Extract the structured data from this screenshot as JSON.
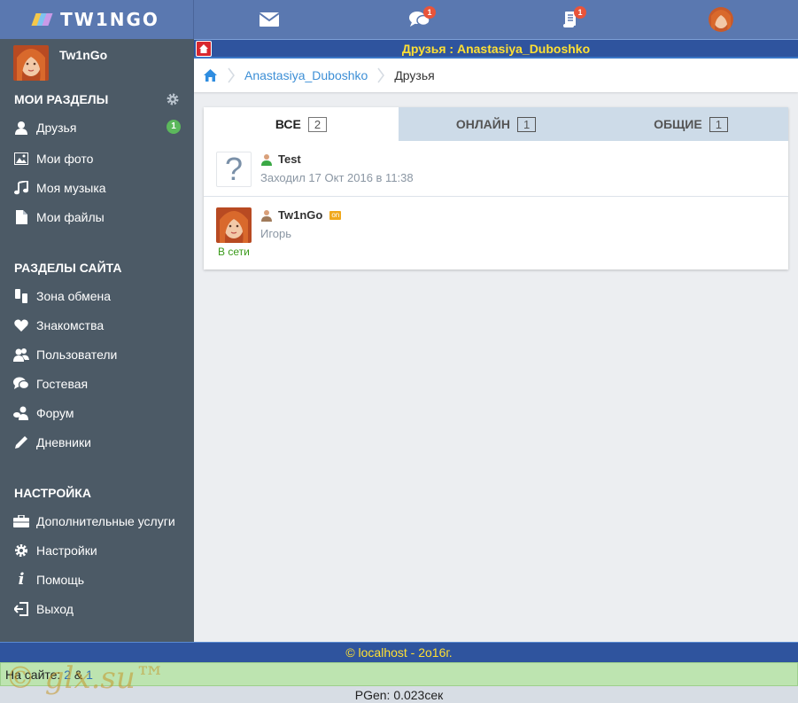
{
  "logo": {
    "text": "TW1NGO"
  },
  "topbar": {
    "messages_icon": "envelope-icon",
    "comments_badge": "1",
    "notifications_badge": "1"
  },
  "sidebar": {
    "username": "Tw1nGo",
    "my_sections": {
      "title": "МОИ РАЗДЕЛЫ",
      "items": [
        {
          "label": "Друзья",
          "icon": "user-icon",
          "badge": "1"
        },
        {
          "label": "Мои фото",
          "icon": "picture-icon"
        },
        {
          "label": "Моя музыка",
          "icon": "music-icon"
        },
        {
          "label": "Мои файлы",
          "icon": "file-icon"
        }
      ]
    },
    "site_sections": {
      "title": "РАЗДЕЛЫ САЙТА",
      "items": [
        {
          "label": "Зона обмена",
          "icon": "exchange-icon"
        },
        {
          "label": "Знакомства",
          "icon": "heart-icon"
        },
        {
          "label": "Пользователи",
          "icon": "users-icon"
        },
        {
          "label": "Гостевая",
          "icon": "comments-icon"
        },
        {
          "label": "Форум",
          "icon": "forum-icon"
        },
        {
          "label": "Дневники",
          "icon": "pencil-icon"
        }
      ]
    },
    "settings": {
      "title": "НАСТРОЙКА",
      "items": [
        {
          "label": "Дополнительные услуги",
          "icon": "briefcase-icon"
        },
        {
          "label": "Настройки",
          "icon": "gear-icon"
        },
        {
          "label": "Помощь",
          "icon": "info-icon"
        },
        {
          "label": "Выход",
          "icon": "logout-icon"
        }
      ]
    }
  },
  "page": {
    "strip_title": "Друзья : Anastasiya_Duboshko",
    "breadcrumb": {
      "link": "Anastasiya_Duboshko",
      "current": "Друзья"
    }
  },
  "tabs": [
    {
      "label": "ВСЕ",
      "count": "2"
    },
    {
      "label": "ОНЛАЙН",
      "count": "1"
    },
    {
      "label": "ОБЩИЕ",
      "count": "1"
    }
  ],
  "friends": [
    {
      "name": "Test",
      "sub": "Заходил 17 Окт 2016 в 11:38",
      "avatar": "?"
    },
    {
      "name": "Tw1nGo",
      "sub": "Игорь",
      "badge": "on",
      "status": "В сети"
    }
  ],
  "footer": {
    "copyright": "© localhost - 2o16г.",
    "online_label": "На сайте:",
    "online_count_a": "2",
    "online_amp": "&",
    "online_count_b": "1",
    "pgen": "PGen: 0.023сек",
    "watermark": "© glx.su™"
  },
  "colors": {
    "topbar": "#5a78b0",
    "sidebar": "#4c5a66",
    "strip": "#2f549e",
    "strip_title": "#ffe033",
    "link": "#3d8fd6",
    "online_green": "#3a9a1a"
  }
}
